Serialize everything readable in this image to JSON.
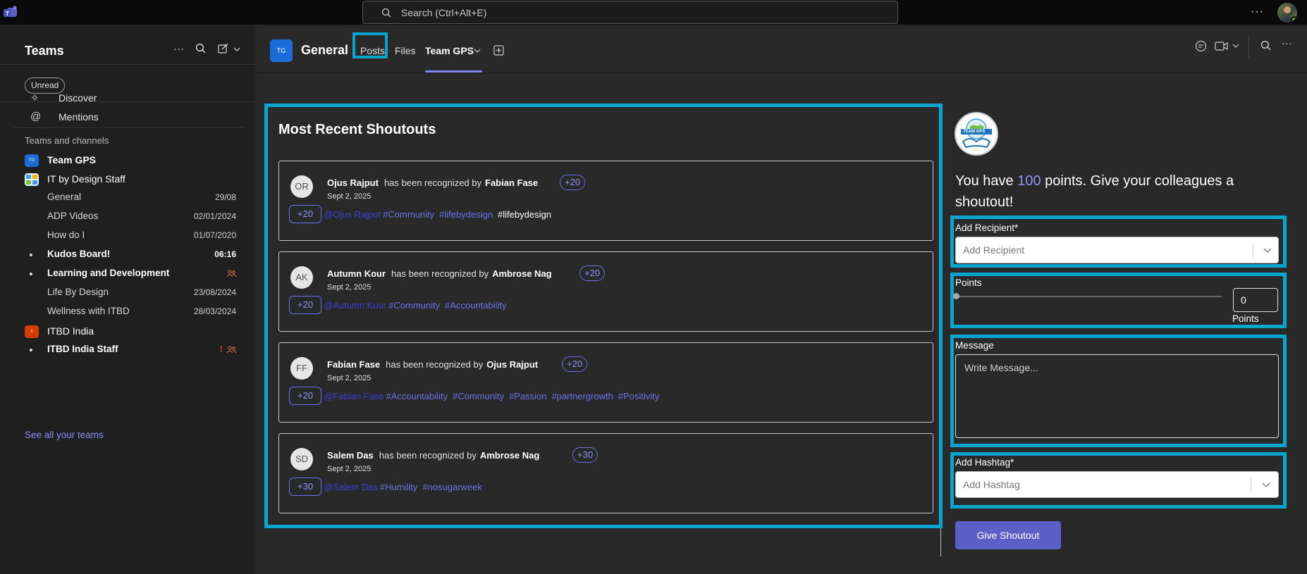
{
  "titlebar": {
    "search_placeholder": "Search (Ctrl+Alt+E)",
    "more_label": "···"
  },
  "sidebar": {
    "title": "Teams",
    "unread_filter": "Unread",
    "nav": [
      {
        "label": "Discover",
        "icon": "sparkle-icon"
      },
      {
        "label": "Mentions",
        "icon": "at-icon"
      }
    ],
    "section_label": "Teams and channels",
    "teams": [
      {
        "name": "Team GPS",
        "avatar": "TG",
        "color": "#1a6cd9",
        "bold": true
      },
      {
        "name": "IT by Design Staff",
        "avatar": "",
        "color": "#33a0d8",
        "bold": false,
        "channels": [
          {
            "name": "General",
            "date": "29/08",
            "bold": false
          },
          {
            "name": "ADP Videos",
            "date": "02/01/2024",
            "bold": false
          },
          {
            "name": "How do I",
            "date": "01/07/2020",
            "bold": false
          },
          {
            "name": "Kudos Board!",
            "date": "06:16",
            "bold": true
          },
          {
            "name": "Learning and Development",
            "date": "",
            "bold": true
          },
          {
            "name": "Life By Design",
            "date": "23/08/2024",
            "bold": false
          },
          {
            "name": "Wellness with ITBD",
            "date": "28/03/2024",
            "bold": false
          }
        ]
      },
      {
        "name": "ITBD India",
        "avatar": "I",
        "color": "#d83b01",
        "bold": false,
        "channels": [
          {
            "name": "ITBD India Staff",
            "date": "",
            "bold": true
          }
        ]
      }
    ],
    "see_all": "See all your teams"
  },
  "channel": {
    "avatar": "TG",
    "name": "General",
    "tabs": [
      "Posts",
      "Files",
      "Team GPS"
    ]
  },
  "shoutouts": {
    "title": "Most Recent Shoutouts",
    "middle_text": "has been recognized by",
    "items": [
      {
        "initials": "OR",
        "recipient": "Ojus Rajput",
        "giver": "Fabian Fase",
        "points": "+20",
        "date": "Sept 2, 2025",
        "mention": "@Ojus Rajput",
        "tags": [
          "#Community",
          "#lifebydesign"
        ],
        "extra": "#lifebydesign"
      },
      {
        "initials": "AK",
        "recipient": "Autumn Kour",
        "giver": "Ambrose Nag",
        "points": "+20",
        "date": "Sept 2, 2025",
        "mention": "@Autumn Kour",
        "tags": [
          "#Community",
          "#Accountability"
        ],
        "extra": ""
      },
      {
        "initials": "FF",
        "recipient": "Fabian Fase",
        "giver": "Ojus Rajput",
        "points": "+20",
        "date": "Sept 2, 2025",
        "mention": "@Fabian Fase",
        "tags": [
          "#Accountability",
          "#Community",
          "#Passion",
          "#partnergrowth",
          "#Positivity"
        ],
        "extra": ""
      },
      {
        "initials": "SD",
        "recipient": "Salem Das",
        "giver": "Ambrose Nag",
        "points": "+30",
        "date": "Sept 2, 2025",
        "mention": "@Salem Das",
        "tags": [
          "#Humility",
          "#nosugarweek"
        ],
        "extra": ""
      }
    ]
  },
  "form": {
    "logo_text": "TEAM GPS",
    "points_pre": "You have ",
    "points_value": "100",
    "points_post": " points. Give your colleagues a shoutout!",
    "recipient_label": "Add Recipient*",
    "recipient_placeholder": "Add Recipient",
    "points_label": "Points",
    "points_value_input": "0",
    "points_unit": "Points",
    "message_label": "Message",
    "message_placeholder": "Write Message...",
    "hashtag_label": "Add Hashtag*",
    "hashtag_placeholder": "Add Hashtag",
    "submit": "Give Shoutout"
  },
  "colors": {
    "accent": "#5b5fc7",
    "highlight": "#0aa5cf",
    "link": "#8b8cf5"
  }
}
